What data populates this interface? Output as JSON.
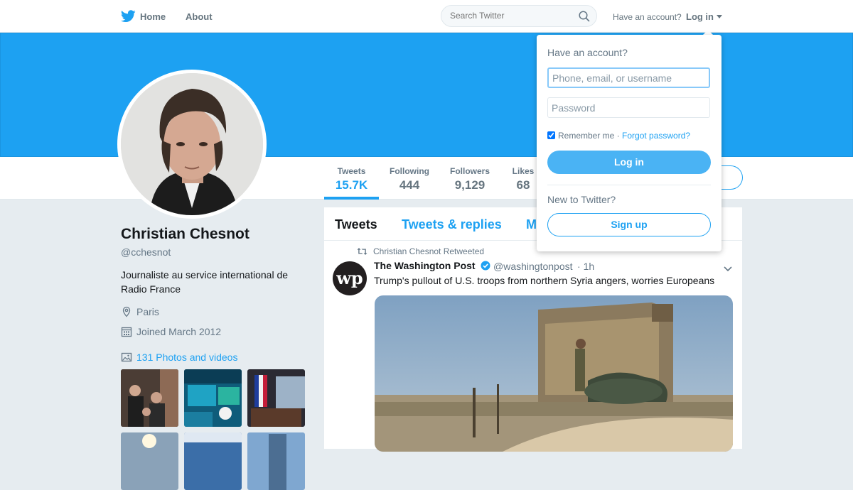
{
  "topbar": {
    "home_label": "Home",
    "about_label": "About",
    "search_placeholder": "Search Twitter",
    "have_account_label": "Have an account?",
    "login_label": "Log in"
  },
  "profile": {
    "name": "Christian Chesnot",
    "handle": "@cchesnot",
    "bio": "Journaliste au service international de Radio France",
    "location": "Paris",
    "joined": "Joined March 2012",
    "photos_link": "131 Photos and videos"
  },
  "stats": [
    {
      "label": "Tweets",
      "value": "15.7K",
      "active": true
    },
    {
      "label": "Following",
      "value": "444",
      "active": false
    },
    {
      "label": "Followers",
      "value": "9,129",
      "active": false
    },
    {
      "label": "Likes",
      "value": "68",
      "active": false
    }
  ],
  "timeline": {
    "tabs": [
      "Tweets",
      "Tweets & replies",
      "M"
    ],
    "retweet_context": "Christian Chesnot Retweeted",
    "tweet": {
      "author_name": "The Washington Post",
      "author_handle": "@washingtonpost",
      "time": "1h",
      "text": "Trump's pullout of U.S. troops from northern Syria angers, worries Europeans",
      "avatar_text": "wp"
    }
  },
  "login_dropdown": {
    "title": "Have an account?",
    "username_placeholder": "Phone, email, or username",
    "password_placeholder": "Password",
    "remember_label": "Remember me",
    "separator": " · ",
    "forgot_label": "Forgot password?",
    "login_button": "Log in",
    "new_label": "New to Twitter?",
    "signup_button": "Sign up"
  },
  "colors": {
    "brand": "#1da1f2",
    "banner": "#1da1f2",
    "background": "#e6ecf0",
    "text_secondary": "#657786"
  },
  "icons": [
    "twitter-bird-icon",
    "search-icon",
    "caret-down-icon",
    "location-icon",
    "calendar-icon",
    "photo-icon",
    "retweet-icon",
    "verified-icon",
    "chevron-down-icon"
  ]
}
